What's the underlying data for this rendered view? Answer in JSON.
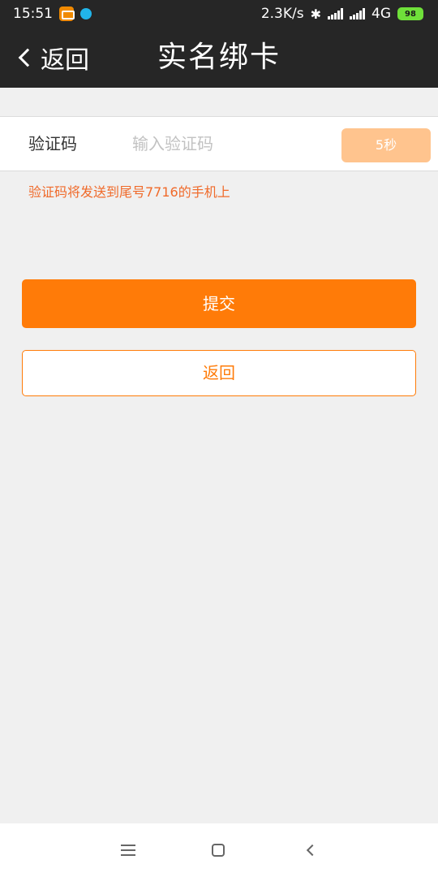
{
  "status_bar": {
    "time": "15:51",
    "speed": "2.3K/s",
    "network": "4G",
    "battery": "98",
    "icons": [
      "orange-app-icon",
      "blue-app-icon",
      "bluetooth-icon",
      "signal-icon",
      "signal-icon",
      "battery-icon"
    ]
  },
  "nav": {
    "back_label": "返回",
    "title": "实名绑卡"
  },
  "form": {
    "code_label": "验证码",
    "code_placeholder": "输入验证码",
    "code_value": "",
    "countdown_label": "5秒",
    "hint": "验证码将发送到尾号7716的手机上"
  },
  "actions": {
    "submit_label": "提交",
    "return_label": "返回"
  },
  "colors": {
    "accent": "#ff7b08",
    "countdown_disabled": "#ffc48e",
    "hint": "#f06a2a",
    "header_bg": "#262626",
    "page_bg": "#f0f0f0"
  }
}
